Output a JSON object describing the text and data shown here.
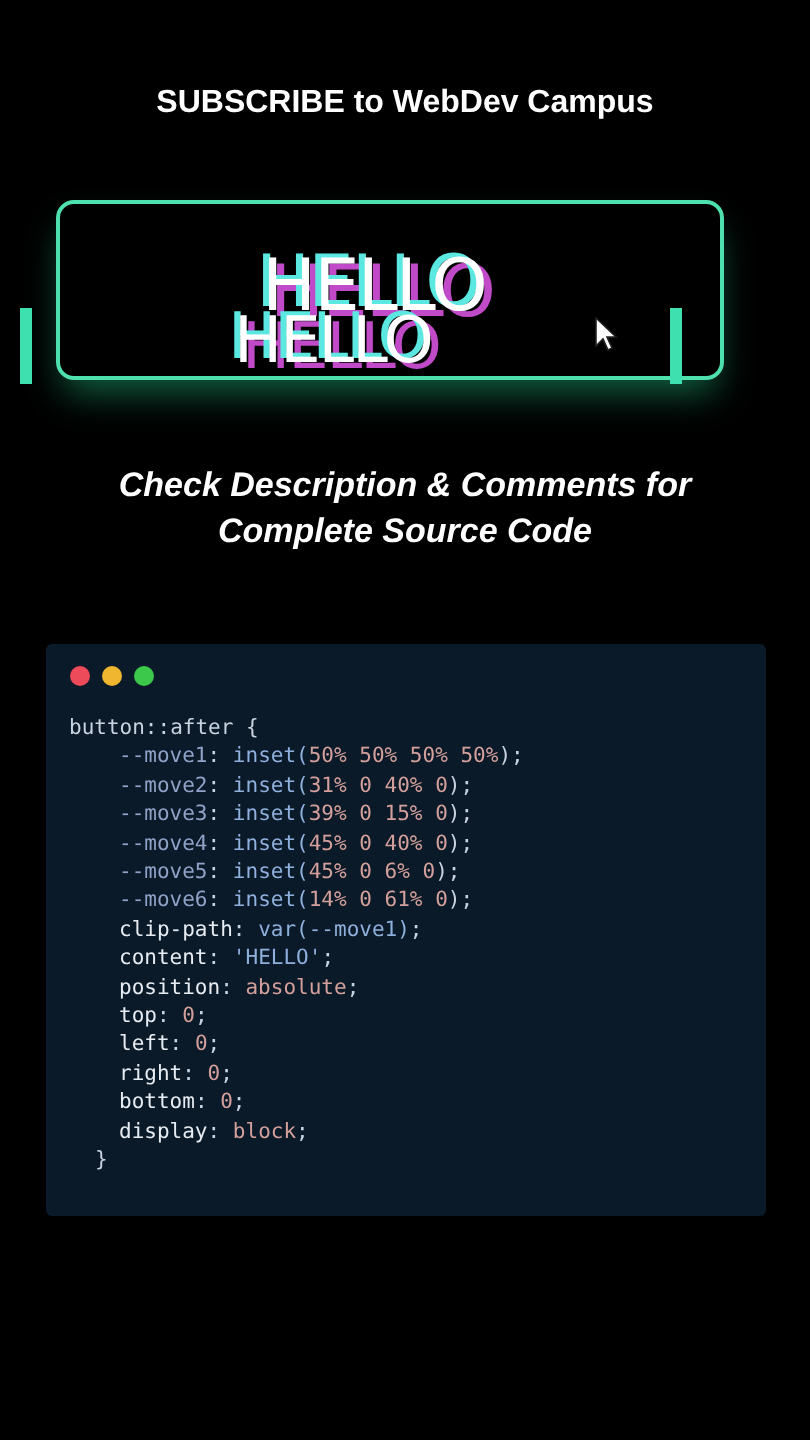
{
  "header": {
    "title": "SUBSCRIBE to WebDev Campus"
  },
  "demo": {
    "texts": [
      "HELLO",
      "HELLO"
    ]
  },
  "caption": {
    "lines": [
      "Check Description & Comments for",
      "Complete Source Code"
    ]
  },
  "code_window": {
    "dots": [
      {
        "color": "#ed4a5a"
      },
      {
        "color": "#f0b630"
      },
      {
        "color": "#3cc84a"
      }
    ],
    "lines": [
      {
        "kind": "open",
        "tokens": [
          {
            "text": "button::after {",
            "kind": "sel"
          }
        ]
      },
      {
        "kind": "custom",
        "tokens": [
          {
            "text": "--move1",
            "kind": "var"
          },
          {
            "text": ": ",
            "kind": "punct"
          },
          {
            "text": "inset(",
            "kind": "func"
          },
          {
            "text": "50% 50% 50% 50%",
            "kind": "num"
          },
          {
            "text": ");",
            "kind": "punct"
          }
        ]
      },
      {
        "kind": "custom",
        "tokens": [
          {
            "text": "--move2",
            "kind": "var"
          },
          {
            "text": ": ",
            "kind": "punct"
          },
          {
            "text": "inset(",
            "kind": "func"
          },
          {
            "text": "31% 0 40% 0",
            "kind": "num"
          },
          {
            "text": ");",
            "kind": "punct"
          }
        ]
      },
      {
        "kind": "custom",
        "tokens": [
          {
            "text": "--move3",
            "kind": "var"
          },
          {
            "text": ": ",
            "kind": "punct"
          },
          {
            "text": "inset(",
            "kind": "func"
          },
          {
            "text": "39% 0 15% 0",
            "kind": "num"
          },
          {
            "text": ");",
            "kind": "punct"
          }
        ]
      },
      {
        "kind": "custom",
        "tokens": [
          {
            "text": "--move4",
            "kind": "var"
          },
          {
            "text": ": ",
            "kind": "punct"
          },
          {
            "text": "inset(",
            "kind": "func"
          },
          {
            "text": "45% 0 40% 0",
            "kind": "num"
          },
          {
            "text": ");",
            "kind": "punct"
          }
        ]
      },
      {
        "kind": "custom",
        "tokens": [
          {
            "text": "--move5",
            "kind": "var"
          },
          {
            "text": ": ",
            "kind": "punct"
          },
          {
            "text": "inset(",
            "kind": "func"
          },
          {
            "text": "45% 0 6% 0",
            "kind": "num"
          },
          {
            "text": ");",
            "kind": "punct"
          }
        ]
      },
      {
        "kind": "custom",
        "tokens": [
          {
            "text": "--move6",
            "kind": "var"
          },
          {
            "text": ": ",
            "kind": "punct"
          },
          {
            "text": "inset(",
            "kind": "func"
          },
          {
            "text": "14% 0 61% 0",
            "kind": "num"
          },
          {
            "text": ");",
            "kind": "punct"
          }
        ]
      },
      {
        "kind": "prop",
        "tokens": [
          {
            "text": "clip-path",
            "kind": "prop"
          },
          {
            "text": ": ",
            "kind": "punct"
          },
          {
            "text": "var(--move1)",
            "kind": "func"
          },
          {
            "text": ";",
            "kind": "punct"
          }
        ]
      },
      {
        "kind": "prop",
        "tokens": [
          {
            "text": "content",
            "kind": "prop"
          },
          {
            "text": ": ",
            "kind": "punct"
          },
          {
            "text": "'HELLO'",
            "kind": "func"
          },
          {
            "text": ";",
            "kind": "punct"
          }
        ]
      },
      {
        "kind": "prop",
        "tokens": [
          {
            "text": "position",
            "kind": "prop"
          },
          {
            "text": ": ",
            "kind": "punct"
          },
          {
            "text": "absolute",
            "kind": "num"
          },
          {
            "text": ";",
            "kind": "punct"
          }
        ]
      },
      {
        "kind": "prop",
        "tokens": [
          {
            "text": "top",
            "kind": "prop"
          },
          {
            "text": ": ",
            "kind": "punct"
          },
          {
            "text": "0",
            "kind": "num"
          },
          {
            "text": ";",
            "kind": "punct"
          }
        ]
      },
      {
        "kind": "prop",
        "tokens": [
          {
            "text": "left",
            "kind": "prop"
          },
          {
            "text": ": ",
            "kind": "punct"
          },
          {
            "text": "0",
            "kind": "num"
          },
          {
            "text": ";",
            "kind": "punct"
          }
        ]
      },
      {
        "kind": "prop",
        "tokens": [
          {
            "text": "right",
            "kind": "prop"
          },
          {
            "text": ": ",
            "kind": "punct"
          },
          {
            "text": "0",
            "kind": "num"
          },
          {
            "text": ";",
            "kind": "punct"
          }
        ]
      },
      {
        "kind": "prop",
        "tokens": [
          {
            "text": "bottom",
            "kind": "prop"
          },
          {
            "text": ": ",
            "kind": "punct"
          },
          {
            "text": "0",
            "kind": "num"
          },
          {
            "text": ";",
            "kind": "punct"
          }
        ]
      },
      {
        "kind": "prop",
        "tokens": [
          {
            "text": "display",
            "kind": "prop"
          },
          {
            "text": ": ",
            "kind": "punct"
          },
          {
            "text": "block",
            "kind": "num"
          },
          {
            "text": ";",
            "kind": "punct"
          }
        ]
      },
      {
        "kind": "close",
        "tokens": [
          {
            "text": "}",
            "kind": "punct"
          }
        ]
      }
    ]
  }
}
